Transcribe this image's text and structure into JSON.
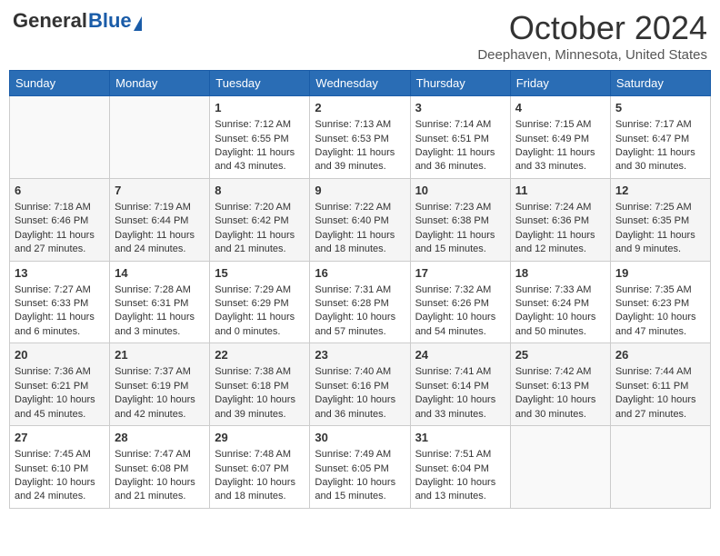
{
  "header": {
    "logo_general": "General",
    "logo_blue": "Blue",
    "title": "October 2024",
    "subtitle": "Deephaven, Minnesota, United States"
  },
  "days_of_week": [
    "Sunday",
    "Monday",
    "Tuesday",
    "Wednesday",
    "Thursday",
    "Friday",
    "Saturday"
  ],
  "weeks": [
    [
      {
        "day": "",
        "empty": true
      },
      {
        "day": "",
        "empty": true
      },
      {
        "day": "1",
        "sunrise": "Sunrise: 7:12 AM",
        "sunset": "Sunset: 6:55 PM",
        "daylight": "Daylight: 11 hours and 43 minutes."
      },
      {
        "day": "2",
        "sunrise": "Sunrise: 7:13 AM",
        "sunset": "Sunset: 6:53 PM",
        "daylight": "Daylight: 11 hours and 39 minutes."
      },
      {
        "day": "3",
        "sunrise": "Sunrise: 7:14 AM",
        "sunset": "Sunset: 6:51 PM",
        "daylight": "Daylight: 11 hours and 36 minutes."
      },
      {
        "day": "4",
        "sunrise": "Sunrise: 7:15 AM",
        "sunset": "Sunset: 6:49 PM",
        "daylight": "Daylight: 11 hours and 33 minutes."
      },
      {
        "day": "5",
        "sunrise": "Sunrise: 7:17 AM",
        "sunset": "Sunset: 6:47 PM",
        "daylight": "Daylight: 11 hours and 30 minutes."
      }
    ],
    [
      {
        "day": "6",
        "sunrise": "Sunrise: 7:18 AM",
        "sunset": "Sunset: 6:46 PM",
        "daylight": "Daylight: 11 hours and 27 minutes."
      },
      {
        "day": "7",
        "sunrise": "Sunrise: 7:19 AM",
        "sunset": "Sunset: 6:44 PM",
        "daylight": "Daylight: 11 hours and 24 minutes."
      },
      {
        "day": "8",
        "sunrise": "Sunrise: 7:20 AM",
        "sunset": "Sunset: 6:42 PM",
        "daylight": "Daylight: 11 hours and 21 minutes."
      },
      {
        "day": "9",
        "sunrise": "Sunrise: 7:22 AM",
        "sunset": "Sunset: 6:40 PM",
        "daylight": "Daylight: 11 hours and 18 minutes."
      },
      {
        "day": "10",
        "sunrise": "Sunrise: 7:23 AM",
        "sunset": "Sunset: 6:38 PM",
        "daylight": "Daylight: 11 hours and 15 minutes."
      },
      {
        "day": "11",
        "sunrise": "Sunrise: 7:24 AM",
        "sunset": "Sunset: 6:36 PM",
        "daylight": "Daylight: 11 hours and 12 minutes."
      },
      {
        "day": "12",
        "sunrise": "Sunrise: 7:25 AM",
        "sunset": "Sunset: 6:35 PM",
        "daylight": "Daylight: 11 hours and 9 minutes."
      }
    ],
    [
      {
        "day": "13",
        "sunrise": "Sunrise: 7:27 AM",
        "sunset": "Sunset: 6:33 PM",
        "daylight": "Daylight: 11 hours and 6 minutes."
      },
      {
        "day": "14",
        "sunrise": "Sunrise: 7:28 AM",
        "sunset": "Sunset: 6:31 PM",
        "daylight": "Daylight: 11 hours and 3 minutes."
      },
      {
        "day": "15",
        "sunrise": "Sunrise: 7:29 AM",
        "sunset": "Sunset: 6:29 PM",
        "daylight": "Daylight: 11 hours and 0 minutes."
      },
      {
        "day": "16",
        "sunrise": "Sunrise: 7:31 AM",
        "sunset": "Sunset: 6:28 PM",
        "daylight": "Daylight: 10 hours and 57 minutes."
      },
      {
        "day": "17",
        "sunrise": "Sunrise: 7:32 AM",
        "sunset": "Sunset: 6:26 PM",
        "daylight": "Daylight: 10 hours and 54 minutes."
      },
      {
        "day": "18",
        "sunrise": "Sunrise: 7:33 AM",
        "sunset": "Sunset: 6:24 PM",
        "daylight": "Daylight: 10 hours and 50 minutes."
      },
      {
        "day": "19",
        "sunrise": "Sunrise: 7:35 AM",
        "sunset": "Sunset: 6:23 PM",
        "daylight": "Daylight: 10 hours and 47 minutes."
      }
    ],
    [
      {
        "day": "20",
        "sunrise": "Sunrise: 7:36 AM",
        "sunset": "Sunset: 6:21 PM",
        "daylight": "Daylight: 10 hours and 45 minutes."
      },
      {
        "day": "21",
        "sunrise": "Sunrise: 7:37 AM",
        "sunset": "Sunset: 6:19 PM",
        "daylight": "Daylight: 10 hours and 42 minutes."
      },
      {
        "day": "22",
        "sunrise": "Sunrise: 7:38 AM",
        "sunset": "Sunset: 6:18 PM",
        "daylight": "Daylight: 10 hours and 39 minutes."
      },
      {
        "day": "23",
        "sunrise": "Sunrise: 7:40 AM",
        "sunset": "Sunset: 6:16 PM",
        "daylight": "Daylight: 10 hours and 36 minutes."
      },
      {
        "day": "24",
        "sunrise": "Sunrise: 7:41 AM",
        "sunset": "Sunset: 6:14 PM",
        "daylight": "Daylight: 10 hours and 33 minutes."
      },
      {
        "day": "25",
        "sunrise": "Sunrise: 7:42 AM",
        "sunset": "Sunset: 6:13 PM",
        "daylight": "Daylight: 10 hours and 30 minutes."
      },
      {
        "day": "26",
        "sunrise": "Sunrise: 7:44 AM",
        "sunset": "Sunset: 6:11 PM",
        "daylight": "Daylight: 10 hours and 27 minutes."
      }
    ],
    [
      {
        "day": "27",
        "sunrise": "Sunrise: 7:45 AM",
        "sunset": "Sunset: 6:10 PM",
        "daylight": "Daylight: 10 hours and 24 minutes."
      },
      {
        "day": "28",
        "sunrise": "Sunrise: 7:47 AM",
        "sunset": "Sunset: 6:08 PM",
        "daylight": "Daylight: 10 hours and 21 minutes."
      },
      {
        "day": "29",
        "sunrise": "Sunrise: 7:48 AM",
        "sunset": "Sunset: 6:07 PM",
        "daylight": "Daylight: 10 hours and 18 minutes."
      },
      {
        "day": "30",
        "sunrise": "Sunrise: 7:49 AM",
        "sunset": "Sunset: 6:05 PM",
        "daylight": "Daylight: 10 hours and 15 minutes."
      },
      {
        "day": "31",
        "sunrise": "Sunrise: 7:51 AM",
        "sunset": "Sunset: 6:04 PM",
        "daylight": "Daylight: 10 hours and 13 minutes."
      },
      {
        "day": "",
        "empty": true
      },
      {
        "day": "",
        "empty": true
      }
    ]
  ]
}
